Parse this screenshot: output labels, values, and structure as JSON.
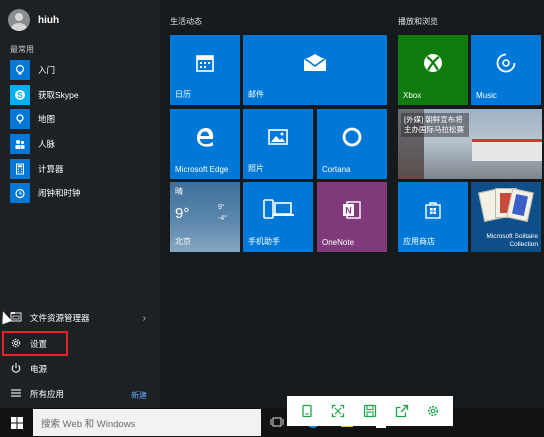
{
  "user": {
    "name": "hiuh"
  },
  "left_menu": {
    "most_used_label": "最常用",
    "apps": [
      {
        "label": "入门",
        "icon": "lightbulb-icon",
        "color": "#0078d7"
      },
      {
        "label": "获取Skype",
        "icon": "skype-icon",
        "color": "#00aff0"
      },
      {
        "label": "地图",
        "icon": "maps-icon",
        "color": "#0078d7"
      },
      {
        "label": "人脉",
        "icon": "people-icon",
        "color": "#0078d7"
      },
      {
        "label": "计算器",
        "icon": "calculator-icon",
        "color": "#0078d7"
      },
      {
        "label": "闹钟和时钟",
        "icon": "alarm-icon",
        "color": "#0078d7"
      }
    ],
    "file_explorer": "文件资源管理器",
    "settings": "设置",
    "power": "电源",
    "all_apps": "所有应用",
    "new_badge": "新建"
  },
  "groups": {
    "life": "生活动态",
    "play": "播放和浏览"
  },
  "tiles": {
    "calendar": "日历",
    "mail": "邮件",
    "edge": "Microsoft Edge",
    "photos": "照片",
    "cortana": "Cortana",
    "weather_condition": "晴",
    "weather_temp": "9°",
    "weather_high": "9°",
    "weather_low": "-4°",
    "weather_city": "北京",
    "phone": "手机助手",
    "onenote": "OneNote",
    "xbox": "Xbox",
    "music": "Music",
    "news_headline": "[外媒] 朝鲜宣布将主办国际马拉松赛",
    "store": "应用商店",
    "solitaire": "Microsoft Solitaire Collection"
  },
  "taskbar": {
    "search_placeholder": "搜索 Web 和 Windows"
  },
  "colors": {
    "tile_blue": "#0078d7",
    "xbox_green": "#107c10",
    "onenote_purple": "#80397b",
    "settings_highlight": "#e0262b",
    "toolbar_green": "#1ea54a"
  }
}
